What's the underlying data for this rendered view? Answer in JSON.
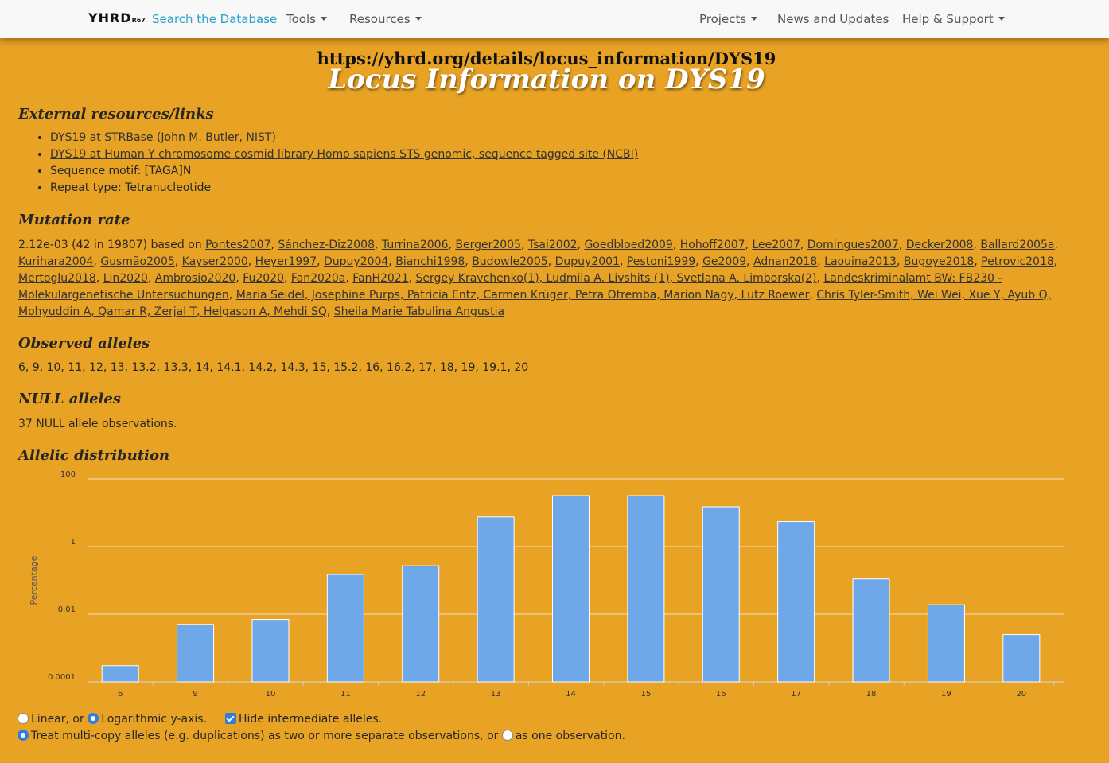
{
  "nav": {
    "brand": "YHRD",
    "brand_release": "R67",
    "search": "Search the Database",
    "tools": "Tools",
    "resources": "Resources",
    "projects": "Projects",
    "news": "News and Updates",
    "help": "Help & Support"
  },
  "page": {
    "url": "https://yhrd.org/details/locus_information/DYS19",
    "title": "Locus Information on DYS19"
  },
  "external": {
    "heading": "External resources/links",
    "links": [
      "DYS19 at STRBase (John M. Butler, NIST)",
      "DYS19 at Human Y chromosome cosmid library Homo sapiens STS genomic, sequence tagged site (NCBI)"
    ],
    "motif": "Sequence motif: [TAGA]N",
    "repeat": "Repeat type: Tetranucleotide"
  },
  "mutation": {
    "heading": "Mutation rate",
    "prefix": "2.12e-03 (42 in 19807) based on",
    "refs": [
      "Pontes2007",
      "Sánchez-Diz2008",
      "Turrina2006",
      "Berger2005",
      "Tsai2002",
      "Goedbloed2009",
      "Hohoff2007",
      "Lee2007",
      "Domingues2007",
      "Decker2008",
      "Ballard2005a",
      "Kurihara2004",
      "Gusmão2005",
      "Kayser2000",
      "Heyer1997",
      "Dupuy2004",
      "Bianchi1998",
      "Budowle2005",
      "Dupuy2001",
      "Pestoni1999",
      "Ge2009",
      "Adnan2018",
      "Laouina2013",
      "Bugoye2018",
      "Petrovic2018",
      "Mertoglu2018",
      "Lin2020",
      "Ambrosio2020",
      "Fu2020",
      "Fan2020a",
      "FanH2021",
      "Sergey Kravchenko(1), Ludmila A. Livshits (1), Svetlana A. Limborska(2)",
      "Landeskriminalamt BW: FB230 - Molekulargenetische Untersuchungen",
      "Maria Seidel, Josephine Purps, Patricia Entz, Carmen Krüger, Petra Otremba, Marion Nagy, Lutz Roewer",
      "Chris Tyler-Smith, Wei Wei, Xue Y, Ayub Q, Mohyuddin A, Qamar R, Zerjal T, Helgason A, Mehdi SQ",
      "Sheila Marie Tabulina Angustia"
    ]
  },
  "observed": {
    "heading": "Observed alleles",
    "text": "6, 9, 10, 11, 12, 13, 13.2, 13.3, 14, 14.1, 14.2, 14.3, 15, 15.2, 16, 16.2, 17, 18, 19, 19.1, 20"
  },
  "null_alleles": {
    "heading": "NULL alleles",
    "text": "37 NULL allele observations."
  },
  "distribution": {
    "heading": "Allelic distribution"
  },
  "chart_data": {
    "type": "bar",
    "title": "",
    "xlabel": "",
    "ylabel": "Percentage",
    "yscale": "log",
    "ylim": [
      0.0001,
      100
    ],
    "yticks": [
      "100",
      "1",
      "0.01",
      "0.0001"
    ],
    "ytick_values": [
      100,
      1,
      0.01,
      0.0001
    ],
    "grid": true,
    "bar_color": "#6fa8e8",
    "categories": [
      "6",
      "9",
      "10",
      "11",
      "12",
      "13",
      "14",
      "15",
      "16",
      "17",
      "18",
      "19",
      "20"
    ],
    "values": [
      0.0003,
      0.005,
      0.007,
      0.15,
      0.27,
      7.5,
      32,
      32,
      15,
      5.5,
      0.11,
      0.019,
      0.0025
    ]
  },
  "controls": {
    "linear": "Linear, or",
    "log": "Logarithmic y-axis.",
    "hide": "Hide intermediate alleles.",
    "multi_separate": "Treat multi-copy alleles (e.g. duplications) as two or more separate observations, or",
    "multi_one": "as one observation."
  }
}
